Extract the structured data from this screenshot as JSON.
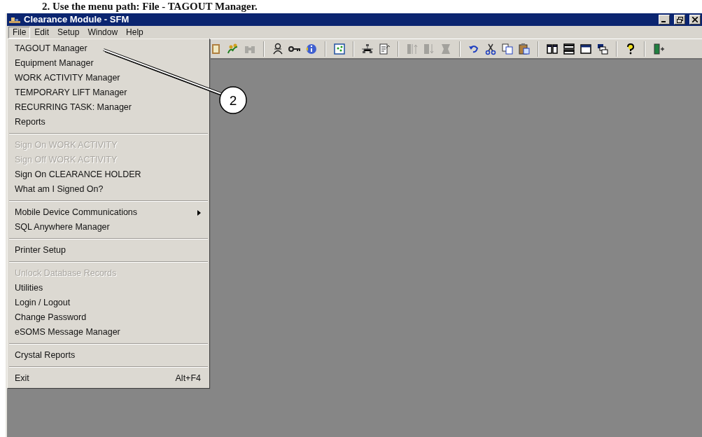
{
  "instruction": "2.   Use the menu path: File - TAGOUT Manager.",
  "window": {
    "title": "Clearance Module - SFM"
  },
  "menu_bar": [
    {
      "label": "File",
      "selected": true
    },
    {
      "label": "Edit",
      "selected": false
    },
    {
      "label": "Setup",
      "selected": false
    },
    {
      "label": "Window",
      "selected": false
    },
    {
      "label": "Help",
      "selected": false
    }
  ],
  "toolbar": [
    {
      "kind": "notebook",
      "disabled": false
    },
    {
      "kind": "people",
      "disabled": false
    },
    {
      "kind": "binoculars",
      "disabled": true
    },
    {
      "kind": "separator"
    },
    {
      "kind": "person",
      "disabled": false
    },
    {
      "kind": "key",
      "disabled": false
    },
    {
      "kind": "info",
      "disabled": false
    },
    {
      "kind": "separator"
    },
    {
      "kind": "grid",
      "disabled": false
    },
    {
      "kind": "separator"
    },
    {
      "kind": "hierarchy",
      "disabled": false
    },
    {
      "kind": "document",
      "disabled": false
    },
    {
      "kind": "separator"
    },
    {
      "kind": "bars-up",
      "disabled": true
    },
    {
      "kind": "bars-down",
      "disabled": true
    },
    {
      "kind": "bars",
      "disabled": true
    },
    {
      "kind": "separator"
    },
    {
      "kind": "undo",
      "disabled": false
    },
    {
      "kind": "cut",
      "disabled": false
    },
    {
      "kind": "copy",
      "disabled": false
    },
    {
      "kind": "paste",
      "disabled": false
    },
    {
      "kind": "separator"
    },
    {
      "kind": "tile-vertical",
      "disabled": false
    },
    {
      "kind": "tile-horizontal",
      "disabled": false
    },
    {
      "kind": "window",
      "disabled": false
    },
    {
      "kind": "cascade",
      "disabled": false
    },
    {
      "kind": "separator"
    },
    {
      "kind": "help",
      "disabled": false
    },
    {
      "kind": "separator"
    },
    {
      "kind": "exit",
      "disabled": false
    }
  ],
  "file_menu": [
    {
      "kind": "item",
      "label": "TAGOUT Manager",
      "disabled": false
    },
    {
      "kind": "item",
      "label": "Equipment Manager",
      "disabled": false
    },
    {
      "kind": "item",
      "label": "WORK ACTIVITY Manager",
      "disabled": false
    },
    {
      "kind": "item",
      "label": "TEMPORARY LIFT Manager",
      "disabled": false
    },
    {
      "kind": "item",
      "label": "RECURRING TASK: Manager",
      "disabled": false
    },
    {
      "kind": "item",
      "label": "Reports",
      "disabled": false
    },
    {
      "kind": "separator"
    },
    {
      "kind": "item",
      "label": "Sign On WORK ACTIVITY",
      "disabled": true
    },
    {
      "kind": "item",
      "label": "Sign Off WORK ACTIVITY",
      "disabled": true
    },
    {
      "kind": "item",
      "label": "Sign On CLEARANCE HOLDER",
      "disabled": false
    },
    {
      "kind": "item",
      "label": "What am I Signed On?",
      "disabled": false
    },
    {
      "kind": "separator"
    },
    {
      "kind": "item",
      "label": "Mobile Device Communications",
      "submenu": true,
      "disabled": false
    },
    {
      "kind": "item",
      "label": "SQL Anywhere Manager",
      "disabled": false
    },
    {
      "kind": "separator"
    },
    {
      "kind": "item",
      "label": "Printer Setup",
      "disabled": false
    },
    {
      "kind": "separator"
    },
    {
      "kind": "item",
      "label": "Unlock Database Records",
      "disabled": true
    },
    {
      "kind": "item",
      "label": "Utilities",
      "disabled": false
    },
    {
      "kind": "item",
      "label": "Login / Logout",
      "disabled": false
    },
    {
      "kind": "item",
      "label": "Change Password",
      "disabled": false
    },
    {
      "kind": "item",
      "label": "eSOMS Message Manager",
      "disabled": false
    },
    {
      "kind": "separator"
    },
    {
      "kind": "item",
      "label": "Crystal Reports",
      "disabled": false
    },
    {
      "kind": "separator"
    },
    {
      "kind": "item",
      "label": "Exit",
      "shortcut": "Alt+F4",
      "disabled": false
    }
  ],
  "callout": {
    "number": "2"
  }
}
